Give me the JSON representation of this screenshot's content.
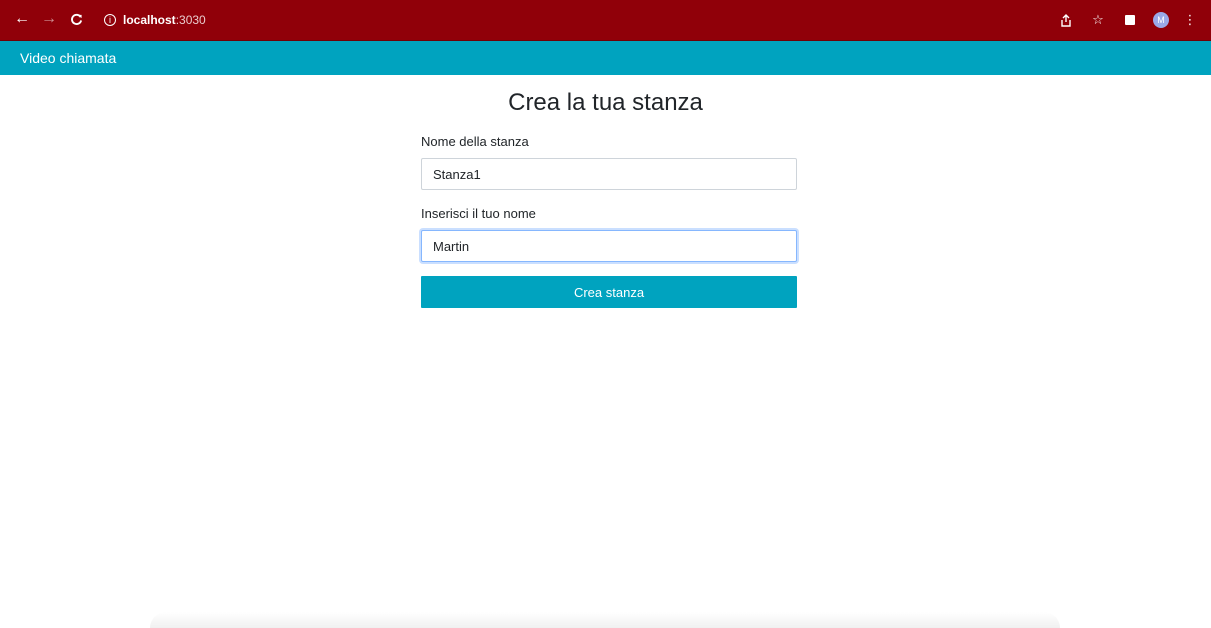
{
  "browser": {
    "url_host": "localhost",
    "url_port": ":3030",
    "info_icon_glyph": "i",
    "avatar_initial": "M",
    "icons": [
      "back-arrow-icon",
      "forward-arrow-icon",
      "reload-icon",
      "info-icon",
      "share-icon",
      "star-icon",
      "sidebar-icon",
      "avatar",
      "menu-dots-icon"
    ]
  },
  "app": {
    "brand": "Video chiamata",
    "accent_color": "#00a3bf"
  },
  "form": {
    "title": "Crea la tua stanza",
    "room_label": "Nome della stanza",
    "room_value": "Stanza1",
    "name_label": "Inserisci il tuo nome",
    "name_value": "Martin",
    "submit_label": "Crea stanza"
  }
}
